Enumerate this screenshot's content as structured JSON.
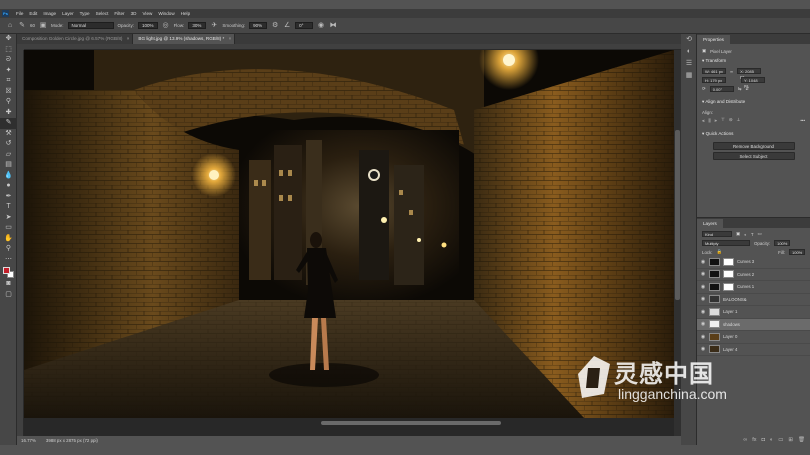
{
  "menu": [
    "File",
    "Edit",
    "Image",
    "Layer",
    "Type",
    "Select",
    "Filter",
    "3D",
    "View",
    "Window",
    "Help"
  ],
  "options_bar": {
    "brush_size": "60",
    "mode_label": "Mode:",
    "mode_value": "Normal",
    "opacity_label": "Opacity:",
    "opacity_value": "100%",
    "flow_label": "Flow:",
    "flow_value": "30%",
    "smoothing_label": "Smoothing:",
    "smoothing_value": "90%",
    "angle_value": "0°"
  },
  "document_tabs": [
    {
      "label": "Composition Golden Circle.jpg @ 6.57% (RGB/8)",
      "active": false
    },
    {
      "label": "BG light.jpg @ 13.9% (shadows, RGB/8) *",
      "active": true
    }
  ],
  "status": {
    "zoom": "16.77%",
    "doc_size": "3988 px x 2875 px (72 ppi)"
  },
  "properties": {
    "tab": "Properties",
    "type": "Pixel Layer",
    "transform_label": "Transform",
    "w": "W: 461 px",
    "h": "H: 179 px",
    "x": "X: 2085 px",
    "y": "Y: 1048 px",
    "angle": "0.00°",
    "align_label": "Align and Distribute",
    "align_sub": "Align:",
    "quick_actions_label": "Quick Actions",
    "remove_bg": "Remove Background",
    "select_subject": "Select Subject"
  },
  "layers_panel": {
    "tab": "Layers",
    "filter": "Kind",
    "blend": "Multiply",
    "opacity_label": "Opacity:",
    "opacity": "100%",
    "fill_label": "Fill:",
    "fill": "100%",
    "lock_label": "Lock:",
    "layers": [
      {
        "name": "Curves 3",
        "sel": false
      },
      {
        "name": "Curves 2",
        "sel": false
      },
      {
        "name": "Curves 1",
        "sel": false
      },
      {
        "name": "BALOONS&",
        "sel": false
      },
      {
        "name": "Layer 1",
        "sel": false
      },
      {
        "name": "shadows",
        "sel": true
      },
      {
        "name": "Layer 0",
        "sel": false
      },
      {
        "name": "Layer 4",
        "sel": false
      }
    ]
  },
  "watermark": {
    "title": "灵感中国",
    "sub": "lingganchina.com"
  },
  "colors": {
    "accent": "#31a8ff",
    "fg_swatch": "#c21f2a",
    "bg_swatch": "#ffffff"
  }
}
